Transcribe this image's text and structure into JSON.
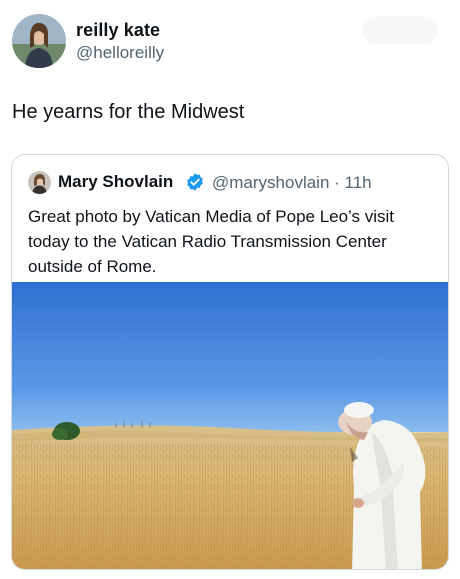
{
  "author": {
    "display_name": "reilly kate",
    "handle": "@helloreilly"
  },
  "post": {
    "text": "He yearns for the Midwest"
  },
  "quoted_post": {
    "display_name": "Mary Shovlain",
    "verified_icon": "verified-badge-icon",
    "handle_time": "@maryshovlain · 11h",
    "text": "Great photo by Vatican Media of Pope Leo’s visit today to the Vatican Radio Transmission Center outside of Rome."
  },
  "colors": {
    "text": "#0f1419",
    "secondary": "#536471",
    "border": "#cfd9de",
    "verified": "#1d9bf0",
    "sky": "#3a7bd5",
    "wheat": "#d8b46a"
  }
}
